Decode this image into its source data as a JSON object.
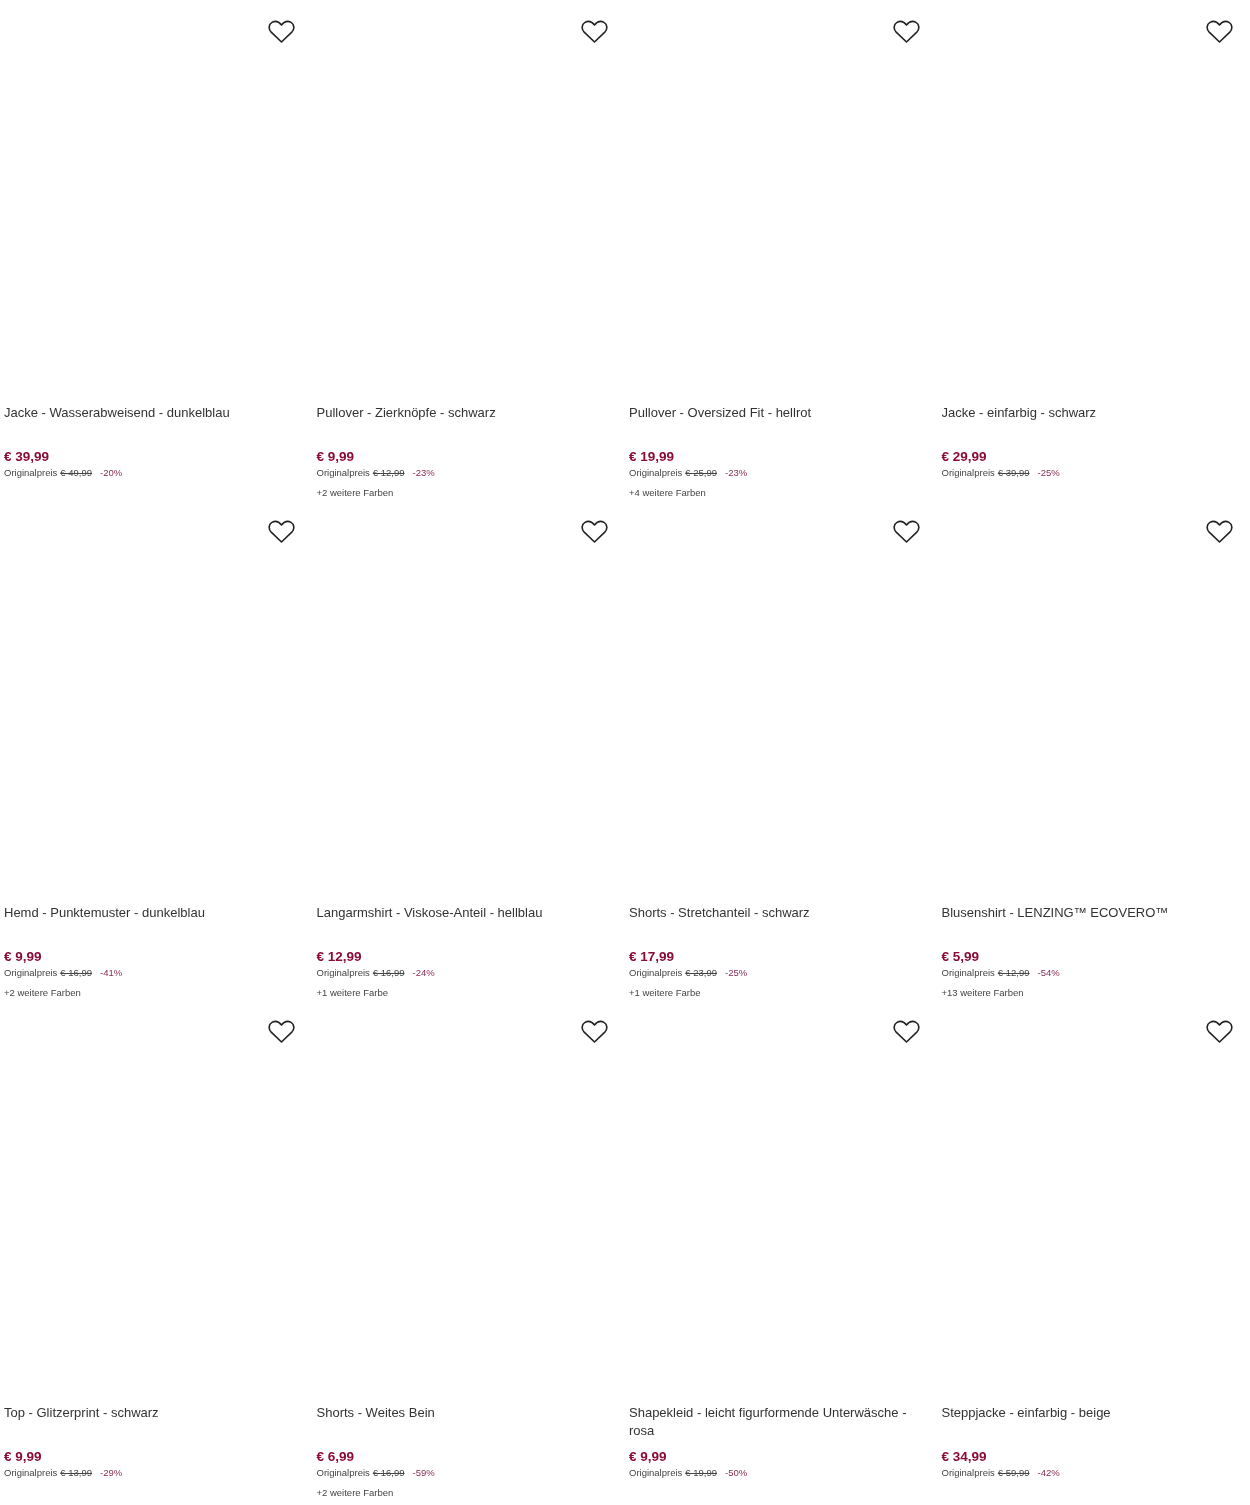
{
  "products": [
    {
      "title": "Jacke - Wasserabweisend - dunkelblau",
      "price": "€ 39,99",
      "original_label": "Originalpreis",
      "original_price": "€ 49,99",
      "discount": "-20%"
    },
    {
      "title": "Pullover - Zierknöpfe - schwarz",
      "price": "€ 9,99",
      "original_label": "Originalpreis",
      "original_price": "€ 12,99",
      "discount": "-23%",
      "colors": "+2 weitere Farben"
    },
    {
      "title": "Pullover - Oversized Fit - hellrot",
      "price": "€ 19,99",
      "original_label": "Originalpreis",
      "original_price": "€ 25,99",
      "discount": "-23%",
      "colors": "+4 weitere Farben"
    },
    {
      "title": "Jacke - einfarbig - schwarz",
      "price": "€ 29,99",
      "original_label": "Originalpreis",
      "original_price": "€ 39,99",
      "discount": "-25%"
    },
    {
      "title": "Hemd - Punktemuster - dunkelblau",
      "price": "€ 9,99",
      "original_label": "Originalpreis",
      "original_price": "€ 16,99",
      "discount": "-41%",
      "colors": "+2 weitere Farben"
    },
    {
      "title": "Langarmshirt - Viskose-Anteil - hellblau",
      "price": "€ 12,99",
      "original_label": "Originalpreis",
      "original_price": "€ 16,99",
      "discount": "-24%",
      "colors": "+1 weitere Farbe"
    },
    {
      "title": "Shorts - Stretchanteil - schwarz",
      "price": "€ 17,99",
      "original_label": "Originalpreis",
      "original_price": "€ 23,99",
      "discount": "-25%",
      "colors": "+1 weitere Farbe"
    },
    {
      "title": "Blusenshirt - LENZING™ ECOVERO™",
      "price": "€ 5,99",
      "original_label": "Originalpreis",
      "original_price": "€ 12,99",
      "discount": "-54%",
      "colors": "+13 weitere Farben"
    },
    {
      "title": "Top - Glitzerprint - schwarz",
      "price": "€ 9,99",
      "original_label": "Originalpreis",
      "original_price": "€ 13,99",
      "discount": "-29%"
    },
    {
      "title": "Shorts - Weites Bein",
      "price": "€ 6,99",
      "original_label": "Originalpreis",
      "original_price": "€ 16,99",
      "discount": "-59%",
      "colors": "+2 weitere Farben"
    },
    {
      "title": "Shapekleid - leicht figurformende Unterwäsche - rosa",
      "price": "€ 9,99",
      "original_label": "Originalpreis",
      "original_price": "€ 19,99",
      "discount": "-50%"
    },
    {
      "title": "Steppjacke - einfarbig - beige",
      "price": "€ 34,99",
      "original_label": "Originalpreis",
      "original_price": "€ 59,99",
      "discount": "-42%"
    }
  ]
}
